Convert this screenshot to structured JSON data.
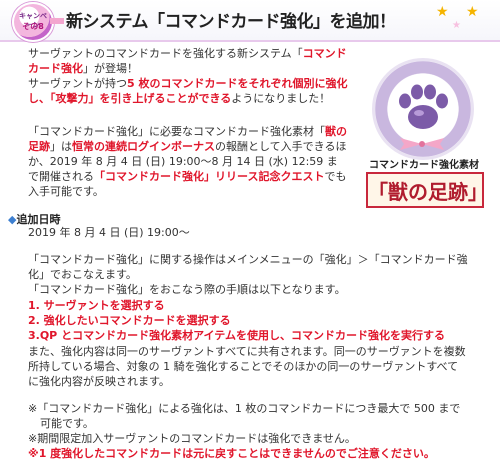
{
  "header": {
    "badge_line1": "キャンペーン",
    "badge_line2": "その8",
    "title": "新システム「コマンドカード強化」を追加！"
  },
  "intro": {
    "l1a": "サーヴァントのコマンドカードを強化する新システム「",
    "l1b": "コマンド",
    "l2a": "カード強化",
    "l2b": "」が登場！",
    "l3a": "サーヴァントが持つ",
    "l3b": "5 枚のコマンドカードをそれぞれ個別に強化",
    "l4a": "し、「攻撃力」を引き上げることができる",
    "l4b": "ようになりました！"
  },
  "material": {
    "l1a": "「コマンドカード強化」に必要なコマンドカード強化素材「",
    "l1b": "獣の",
    "l2a": "足跡",
    "l2b": "」は",
    "l2c": "恒常の連続ログインボーナス",
    "l2d": "の報酬として入手できるほ",
    "l3": "か、2019 年 8 月 4 日 (日) 19:00～8 月 14 日 (水) 12:59 ま",
    "l4a": "で開催される",
    "l4b": "「コマンドカード強化」リリース記念クエスト",
    "l4c": "でも",
    "l5": "入手可能です。"
  },
  "emblem": {
    "caption": "コマンドカード強化素材",
    "name": "「獣の足跡」"
  },
  "schedule": {
    "heading_mark": "◆",
    "heading": "追加日時",
    "date": "2019 年 8 月 4 日 (日) 19:00～"
  },
  "operation": {
    "l1": "「コマンドカード強化」に関する操作はメインメニューの「強化」＞「コマンドカード強",
    "l2": "化」でおこなえます。",
    "l3": "「コマンドカード強化」をおこなう際の手順は以下となります。"
  },
  "steps": [
    "1. サーヴァントを選択する",
    "2. 強化したいコマンドカードを選択する",
    "3.QP とコマンドカード強化素材アイテムを使用し、コマンドカード強化を実行する"
  ],
  "share": {
    "l1": "また、強化内容は同一のサーヴァントすべてに共有されます。同一のサーヴァントを複数",
    "l2": "所持している場合、対象の 1 騎を強化することでそのほかの同一のサーヴァントすべて",
    "l3": "に強化内容が反映されます。"
  },
  "notes": {
    "n1a": "※「コマンドカード強化」による強化は、1 枚のコマンドカードにつき最大で 500 まで",
    "n1b": "可能です。",
    "n2": "※期間限定加入サーヴァントのコマンドカードは強化できません。",
    "n3": "※1 度強化したコマンドカードは元に戻すことはできませんのでご注意ください。"
  },
  "colors": {
    "accent_red": "#e0162b",
    "emblem_border": "#c8283c",
    "emblem_purple": "#a48ac7"
  }
}
